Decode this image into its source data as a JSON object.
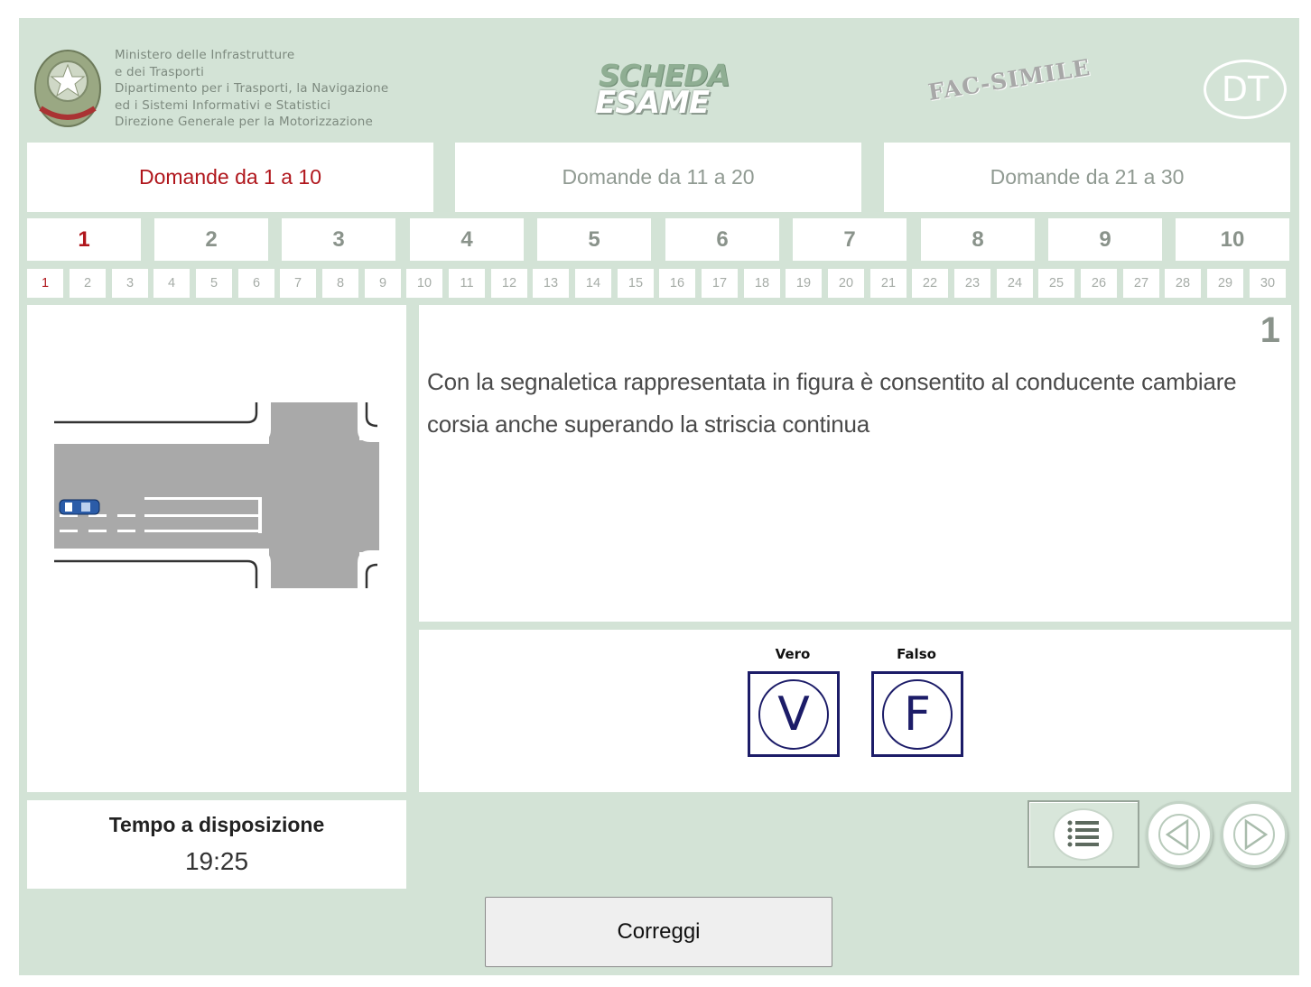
{
  "header": {
    "ministry_lines": [
      "Ministero delle Infrastrutture",
      "e dei Trasporti",
      "Dipartimento per i Trasporti, la Navigazione",
      "ed i Sistemi Informativi e Statistici",
      "Direzione Generale per la Motorizzazione"
    ],
    "logo_line1": "SCHEDA",
    "logo_line2": "ESAME",
    "watermark": "FAC-SIMILE",
    "badge": "DT"
  },
  "range_tabs": [
    {
      "label": "Domande  da 1 a 10",
      "active": true
    },
    {
      "label": "Domande da 11 a 20",
      "active": false
    },
    {
      "label": "Domande da 21 a 30",
      "active": false
    }
  ],
  "question_tabs": [
    "1",
    "2",
    "3",
    "4",
    "5",
    "6",
    "7",
    "8",
    "9",
    "10"
  ],
  "mini_tabs": [
    "1",
    "2",
    "3",
    "4",
    "5",
    "6",
    "7",
    "8",
    "9",
    "10",
    "11",
    "12",
    "13",
    "14",
    "15",
    "16",
    "17",
    "18",
    "19",
    "20",
    "21",
    "22",
    "23",
    "24",
    "25",
    "26",
    "27",
    "28",
    "29",
    "30"
  ],
  "question": {
    "number": "1",
    "text": "Con la segnaletica rappresentata in figura è consentito al conducente cambiare corsia anche superando la striscia continua"
  },
  "answers": {
    "true_label": "Vero",
    "true_symbol": "V",
    "false_label": "Falso",
    "false_symbol": "F"
  },
  "timer": {
    "label": "Tempo a disposizione",
    "value": "19:25"
  },
  "buttons": {
    "correct": "Correggi"
  },
  "icons": {
    "list": "list-icon",
    "prev": "arrow-left-icon",
    "next": "arrow-right-icon"
  },
  "colors": {
    "background": "#d3e3d6",
    "active": "#b0161c",
    "answer_border": "#1c1c68"
  }
}
